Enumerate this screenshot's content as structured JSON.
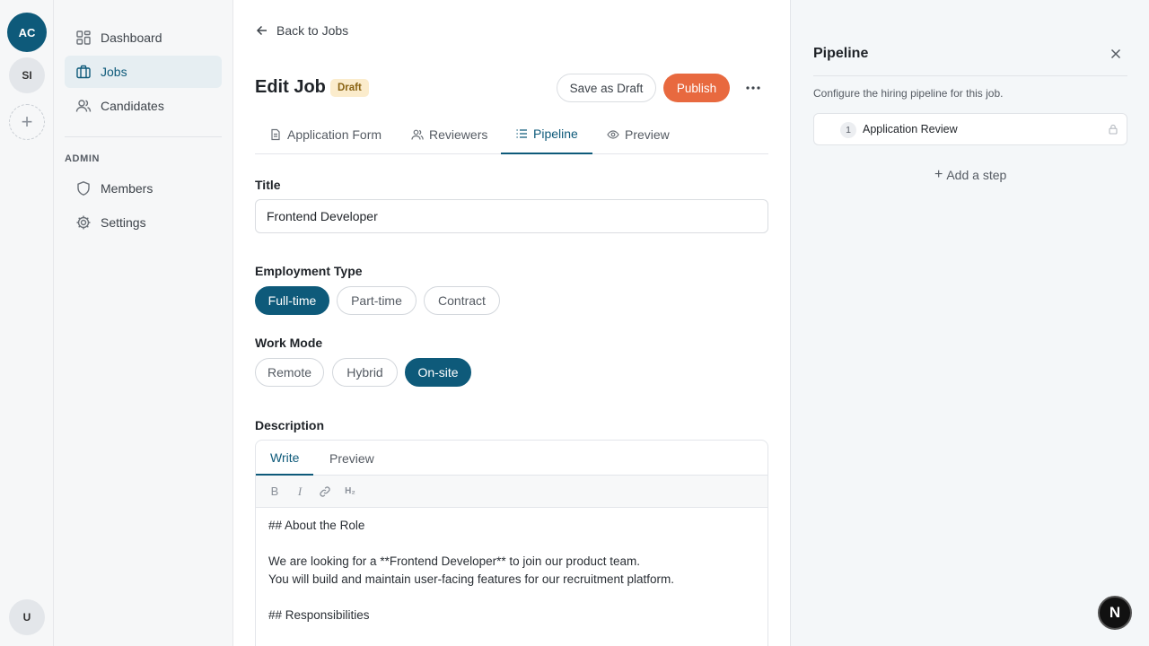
{
  "workspaces": [
    {
      "initials": "AC"
    },
    {
      "initials": "SI"
    }
  ],
  "workspace_add": "+",
  "user_initials": "U",
  "sidebar": {
    "items": [
      {
        "label": "Dashboard",
        "icon": "dashboard-icon"
      },
      {
        "label": "Jobs",
        "icon": "briefcase-icon",
        "active": true
      },
      {
        "label": "Candidates",
        "icon": "users-icon"
      }
    ],
    "admin_label": "ADMIN",
    "admin_items": [
      {
        "label": "Members",
        "icon": "shield-icon"
      },
      {
        "label": "Settings",
        "icon": "gear-icon"
      }
    ]
  },
  "header": {
    "back_label": "Back to Jobs",
    "title": "Edit Job",
    "status_badge": "Draft",
    "save_draft_label": "Save as Draft",
    "publish_label": "Publish"
  },
  "tabs": [
    {
      "label": "Application Form",
      "icon": "document-icon"
    },
    {
      "label": "Reviewers",
      "icon": "users-icon"
    },
    {
      "label": "Pipeline",
      "icon": "list-icon",
      "active": true
    },
    {
      "label": "Preview",
      "icon": "eye-icon"
    }
  ],
  "form": {
    "title_label": "Title",
    "title_value": "Frontend Developer",
    "employment_label": "Employment Type",
    "employment_options": [
      "Full-time",
      "Part-time",
      "Contract"
    ],
    "employment_selected": "Full-time",
    "work_mode_label": "Work Mode",
    "work_mode_options": [
      "Remote",
      "Hybrid",
      "On-site"
    ],
    "work_mode_selected": "On-site",
    "description_label": "Description",
    "editor_tabs": [
      "Write",
      "Preview"
    ],
    "editor_active_tab": "Write",
    "toolbar": {
      "bold": "B",
      "italic": "I",
      "heading": "H₂"
    },
    "description_lines": [
      "## About the Role",
      "",
      "We are looking for a **Frontend Developer** to join our product team.",
      "You will build and maintain user-facing features for our recruitment platform.",
      "",
      "## Responsibilities"
    ]
  },
  "panel": {
    "title": "Pipeline",
    "description": "Configure the hiring pipeline for this job.",
    "steps": [
      {
        "number": "1",
        "label": "Application Review",
        "locked": true
      }
    ],
    "add_step_label": "Add a step"
  },
  "dev_badge": "N",
  "colors": {
    "brand": "#0e5a7a",
    "publish": "#e8693f",
    "draft_badge_bg": "#fbeccc",
    "draft_badge_text": "#8a6414"
  }
}
